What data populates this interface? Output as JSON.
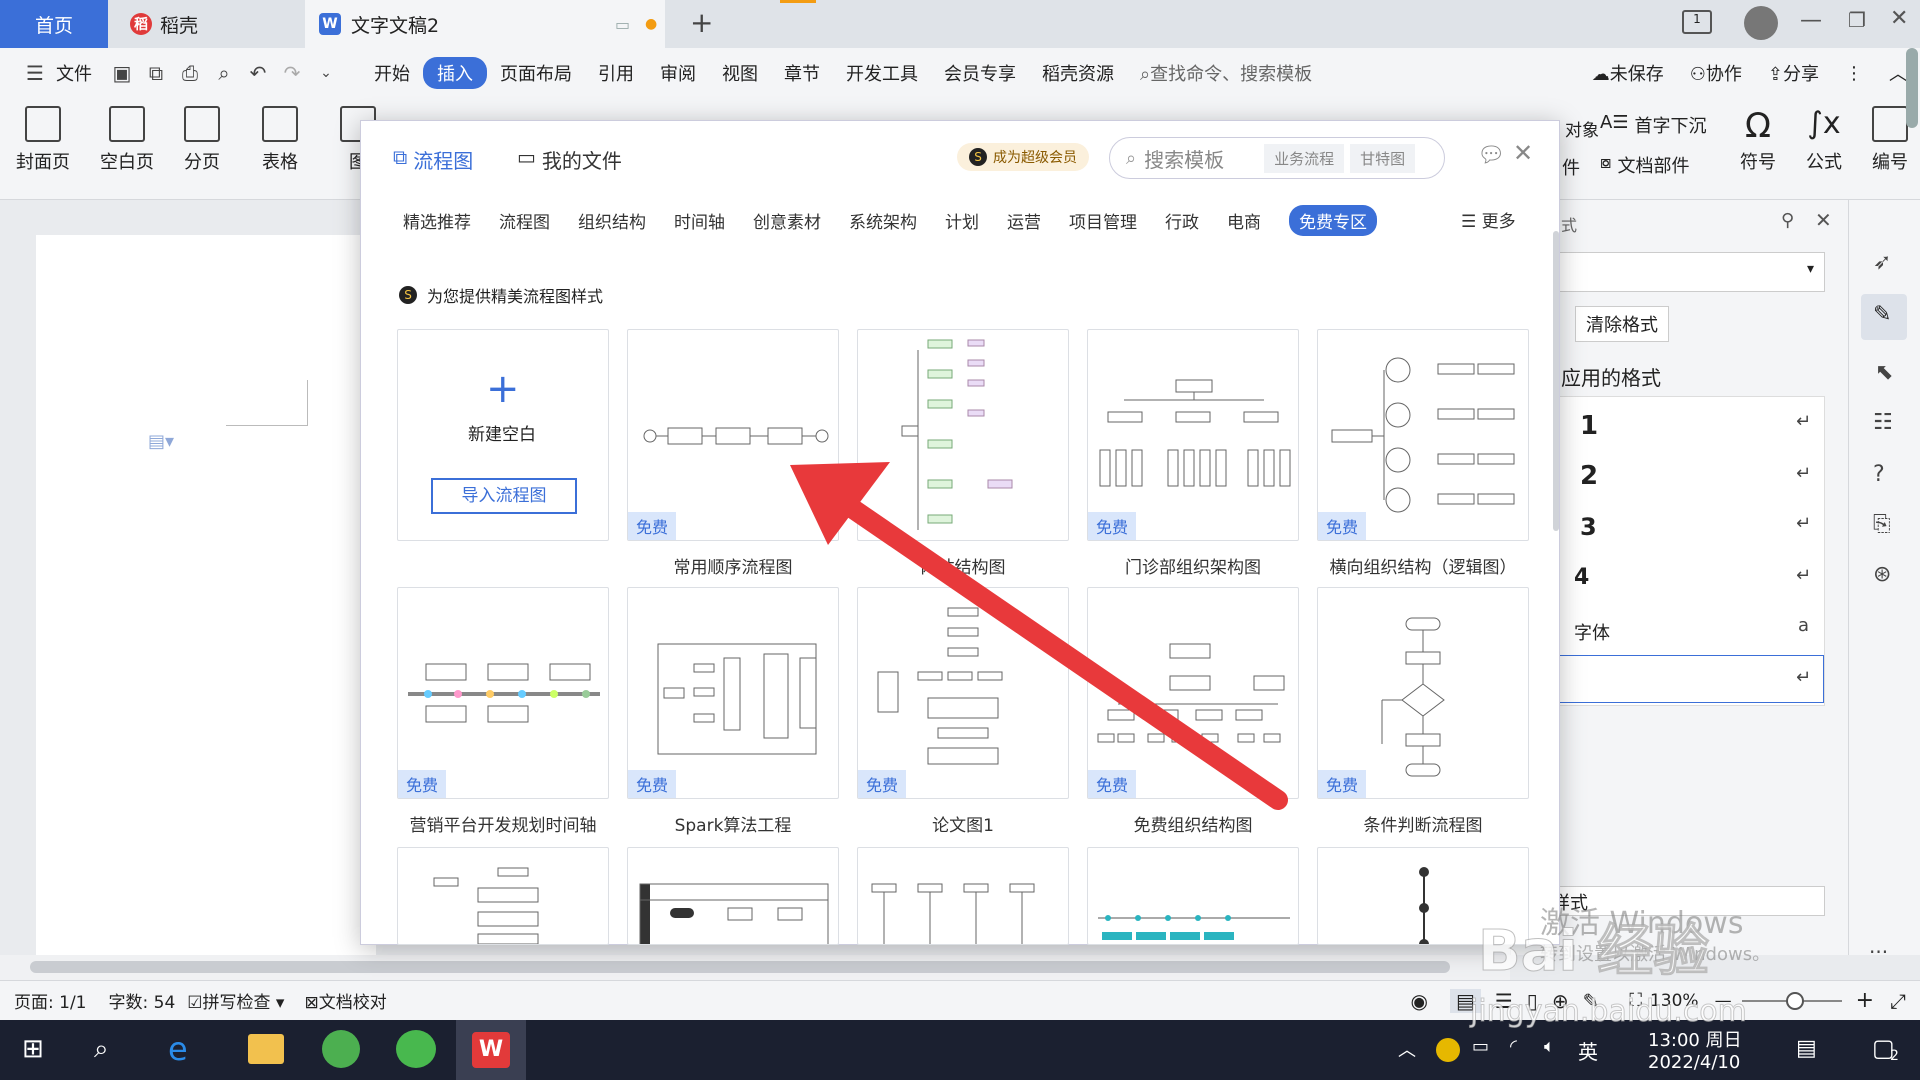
{
  "titlebar": {
    "tabs": [
      "首页",
      "稻壳",
      "文字文稿2"
    ]
  },
  "menu": {
    "file": "文件",
    "items": [
      "开始",
      "插入",
      "页面布局",
      "引用",
      "审阅",
      "视图",
      "章节",
      "开发工具",
      "会员专享",
      "稻壳资源"
    ],
    "search_placeholder": "查找命令、搜索模板",
    "unsaved": "未保存",
    "collab": "协作",
    "share": "分享"
  },
  "ribbon": {
    "left": [
      "封面页",
      "空白页",
      "分页",
      "表格"
    ],
    "right": [
      "首字下沉",
      "文档部件",
      "符号",
      "公式",
      "编号"
    ],
    "right_frag": [
      "对象",
      "件",
      "图"
    ]
  },
  "rightpane": {
    "clear_btn": "清除格式",
    "applied_title": "应用的格式",
    "items": [
      "1",
      "2",
      "3",
      "4",
      "字体"
    ],
    "style_label": "样式",
    "style_frag": "式"
  },
  "modal": {
    "tab_flow": "流程图",
    "tab_files": "我的文件",
    "vip": "成为超级会员",
    "search_placeholder": "搜索模板",
    "chip1": "业务流程",
    "chip2": "甘特图",
    "categories": [
      "精选推荐",
      "流程图",
      "组织结构",
      "时间轴",
      "创意素材",
      "系统架构",
      "计划",
      "运营",
      "项目管理",
      "行政",
      "电商",
      "免费专区"
    ],
    "more": "更多",
    "subtitle": "为您提供精美流程图样式",
    "new_blank": "新建空白",
    "import_btn": "导入流程图",
    "free_badge": "免费",
    "captions": [
      "常用顺序流程图",
      "网站结构图",
      "门诊部组织架构图",
      "横向组织结构（逻辑图）",
      "营销平台开发规划时间轴",
      "Spark算法工程",
      "论文图1",
      "免费组织结构图",
      "条件判断流程图"
    ]
  },
  "status": {
    "page": "页面: 1/1",
    "words": "字数: 54",
    "spell": "拼写检查",
    "proof": "文档校对",
    "zoom": "130%"
  },
  "taskbar": {
    "time": "13:00 周日",
    "date": "2022/4/10",
    "ime": "英",
    "badge": "2"
  },
  "watermark": {
    "win1": "激活 Windows",
    "win2": "转到设置以激活 Windows。",
    "baidu": "Bai 经验",
    "url": "jingyan.baidu.com"
  }
}
